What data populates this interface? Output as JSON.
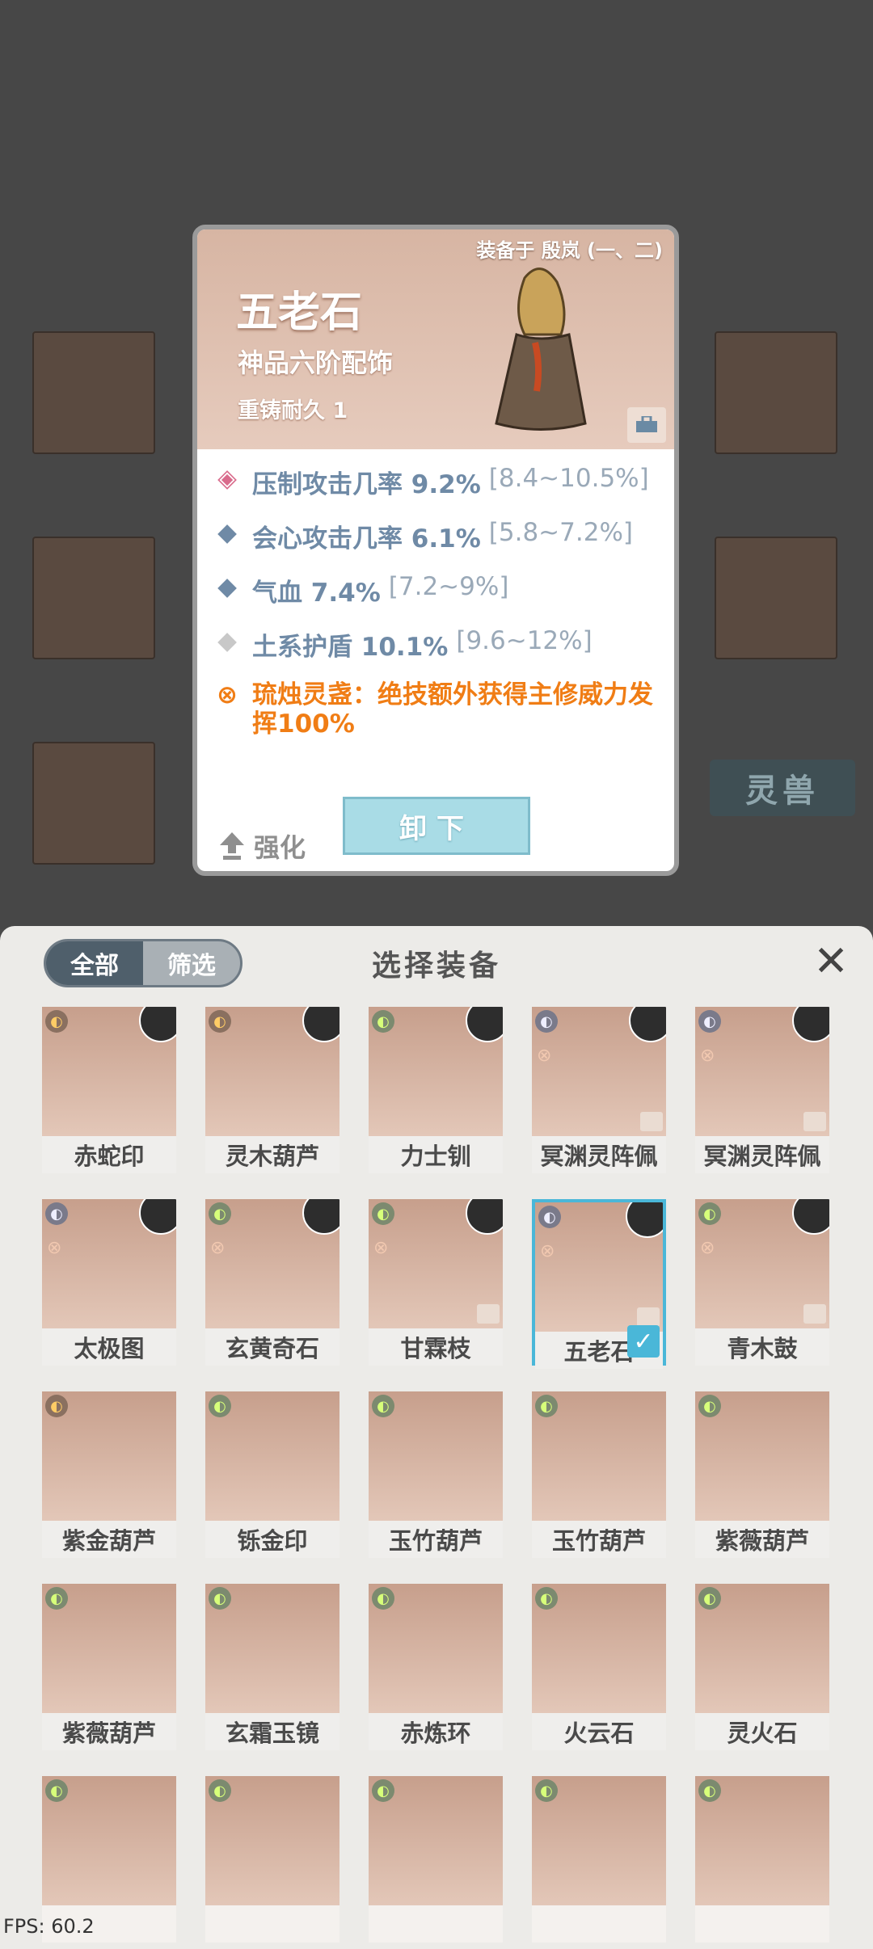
{
  "popup": {
    "equipped_on": "装备于 殷岚 (一、二)",
    "name": "五老石",
    "grade": "神品六阶配饰",
    "recast": "重铸耐久 1",
    "stats": [
      {
        "icon": "fire-diamond-icon",
        "text": "压制攻击几率 9.2%",
        "range": "[8.4~10.5%]"
      },
      {
        "icon": "blue-diamond-icon",
        "text": "会心攻击几率 6.1%",
        "range": "[5.8~7.2%]"
      },
      {
        "icon": "blue-diamond-icon",
        "text": "气血 7.4%",
        "range": "[7.2~9%]"
      },
      {
        "icon": "grey-diamond-icon",
        "text": "土系护盾 10.1%",
        "range": "[9.6~12%]"
      }
    ],
    "special": "琉烛灵盏：绝技额外获得主修威力发挥100%",
    "enhance_label": "强化",
    "unequip_label": "卸下"
  },
  "background": {
    "tab_label": "灵兽"
  },
  "panel": {
    "filter_all": "全部",
    "filter_screen": "筛选",
    "title": "选择装备",
    "items": [
      {
        "name": "赤蛇印"
      },
      {
        "name": "灵木葫芦"
      },
      {
        "name": "力士钏"
      },
      {
        "name": "冥渊灵阵佩"
      },
      {
        "name": "冥渊灵阵佩"
      },
      {
        "name": "太极图"
      },
      {
        "name": "玄黄奇石"
      },
      {
        "name": "甘霖枝"
      },
      {
        "name": "五老石"
      },
      {
        "name": "青木鼓"
      },
      {
        "name": "紫金葫芦"
      },
      {
        "name": "铄金印"
      },
      {
        "name": "玉竹葫芦"
      },
      {
        "name": "玉竹葫芦"
      },
      {
        "name": "紫薇葫芦"
      },
      {
        "name": "紫薇葫芦"
      },
      {
        "name": "玄霜玉镜"
      },
      {
        "name": "赤炼环"
      },
      {
        "name": "火云石"
      },
      {
        "name": "灵火石"
      },
      {
        "name": ""
      },
      {
        "name": ""
      },
      {
        "name": ""
      },
      {
        "name": ""
      },
      {
        "name": ""
      }
    ]
  },
  "fps": "FPS: 60.2",
  "colors": {
    "accent": "#4ab7d8",
    "special": "#f07d15",
    "stat": "#6f8aa6"
  }
}
